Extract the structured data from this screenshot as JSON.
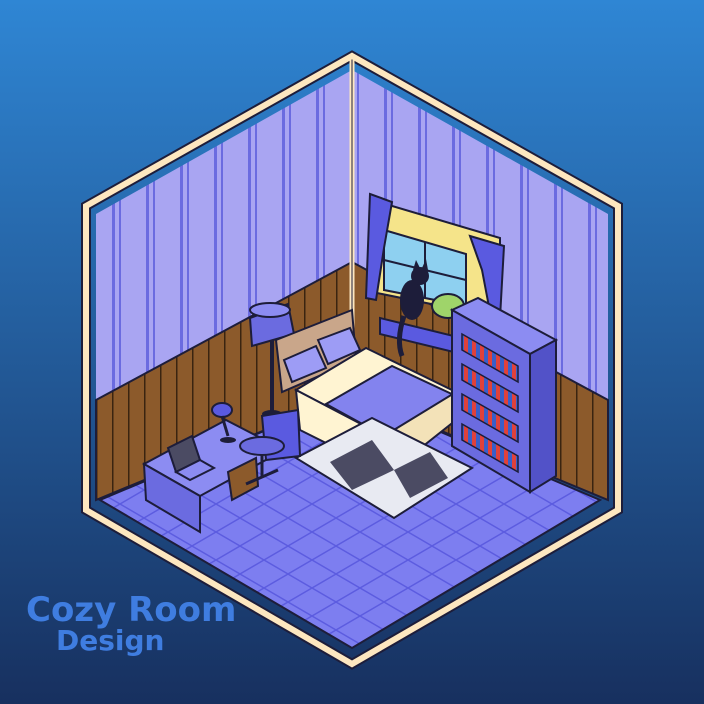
{
  "logo": {
    "line1": "Cozy Room",
    "line2": "Design"
  },
  "colors": {
    "background_top": "#2f86d4",
    "background_bottom": "#17305f",
    "wall": "#a9a5f2",
    "wall_stripe": "#6b6be0",
    "wainscot": "#8c5a2b",
    "floor": "#7d7ef0",
    "frame": "#fde7c0",
    "logo_text": "#3f7de0"
  },
  "objects": [
    "floor-lamp",
    "bed",
    "cat",
    "window",
    "bookshelf",
    "desk",
    "laptop",
    "desk-lamp",
    "office-chair",
    "rug"
  ]
}
